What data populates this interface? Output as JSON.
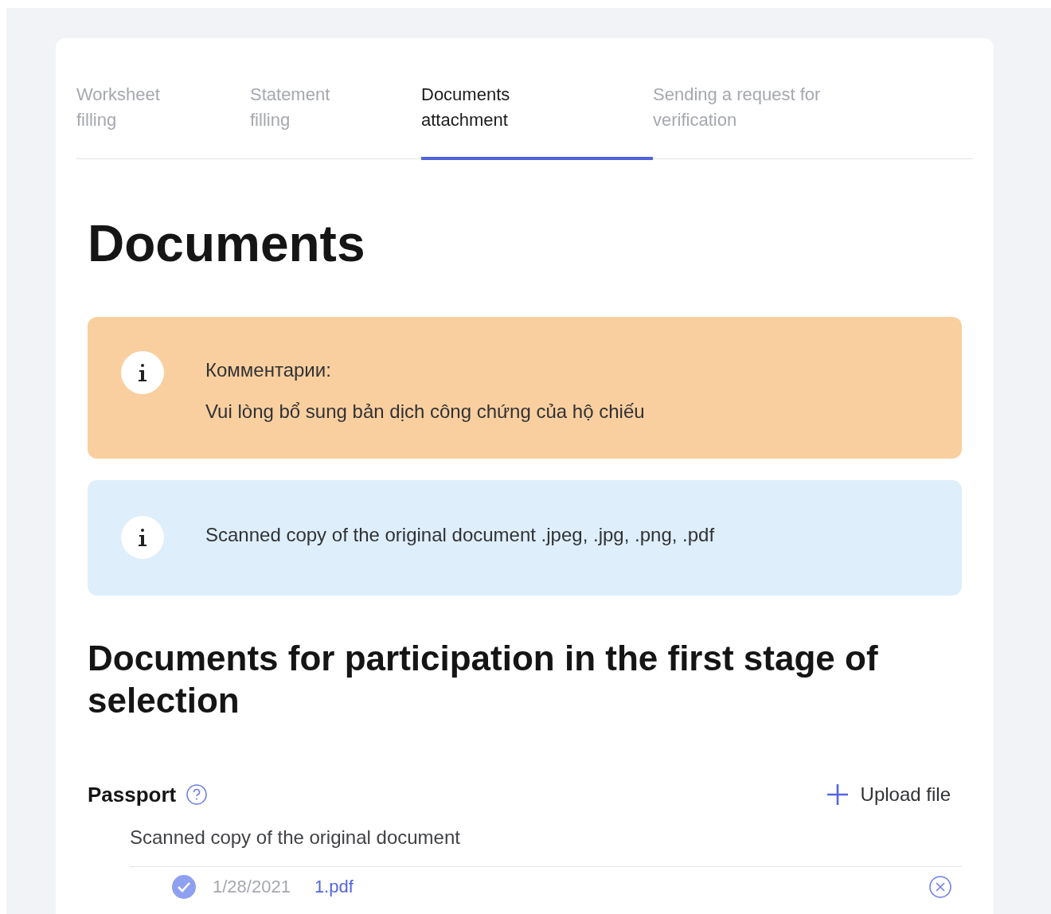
{
  "tabs": [
    {
      "label": "Worksheet filling",
      "selected": false
    },
    {
      "label": "Statement filling",
      "selected": false
    },
    {
      "label": "Documents attachment",
      "selected": true
    },
    {
      "label": "Sending a request for verification",
      "selected": false
    }
  ],
  "title": "Documents",
  "notices": [
    {
      "kind": "warning",
      "lines": [
        "Комментарии:",
        "Vui lòng bổ sung bản dịch công chứng của hộ chiếu"
      ]
    },
    {
      "kind": "info",
      "lines": [
        "Scanned copy of the original document .jpeg, .jpg, .png, .pdf"
      ]
    }
  ],
  "section_title": "Documents for participation in the first stage of selection",
  "documents": [
    {
      "name": "Passport",
      "upload_label": "Upload file",
      "description": "Scanned copy of the original document",
      "files": [
        {
          "date": "1/28/2021",
          "file_name": "1.pdf"
        }
      ]
    }
  ]
}
